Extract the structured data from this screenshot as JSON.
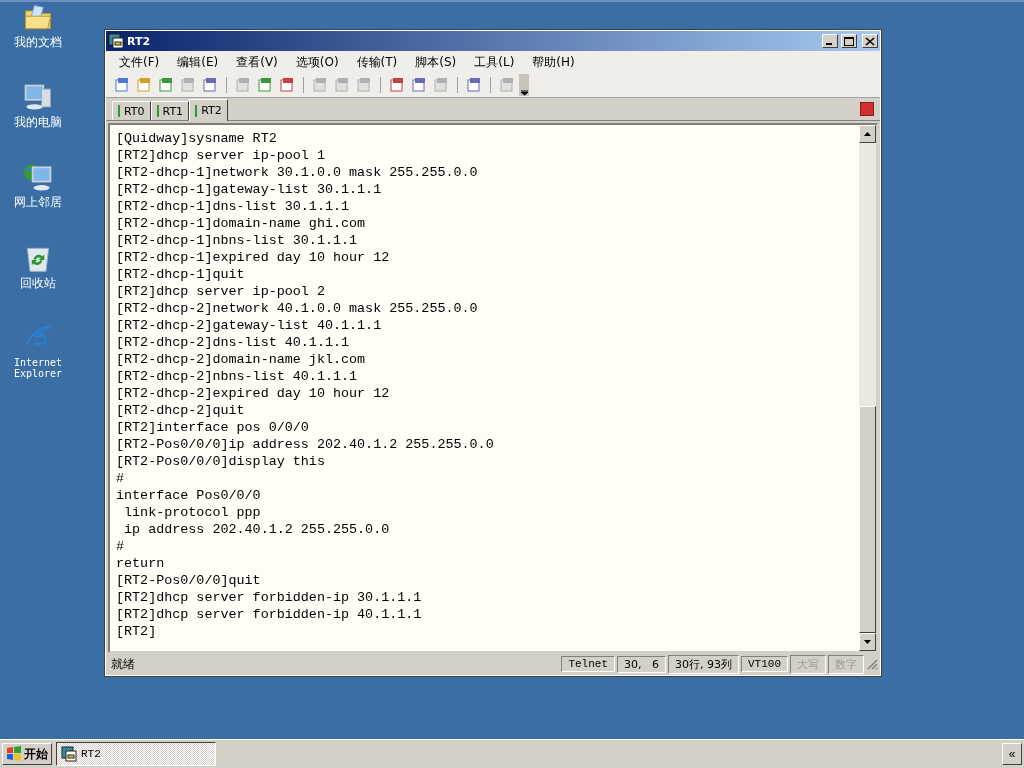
{
  "desktop_icons": [
    {
      "label": "我的文档",
      "kind": "folder"
    },
    {
      "label": "我的电脑",
      "kind": "computer"
    },
    {
      "label": "网上邻居",
      "kind": "network"
    },
    {
      "label": "回收站",
      "kind": "recycle"
    },
    {
      "label": "Internet Explorer",
      "kind": "browser"
    }
  ],
  "window": {
    "title": "RT2"
  },
  "menu": [
    "文件(F)",
    "编辑(E)",
    "查看(V)",
    "选项(O)",
    "传输(T)",
    "脚本(S)",
    "工具(L)",
    "帮助(H)"
  ],
  "toolbar_groups": [
    [
      {
        "disabled": false
      },
      {
        "disabled": false
      },
      {
        "disabled": false
      },
      {
        "disabled": true
      },
      {
        "disabled": false
      }
    ],
    [
      {
        "disabled": true
      },
      {
        "disabled": false
      },
      {
        "disabled": false
      }
    ],
    [
      {
        "disabled": true
      },
      {
        "disabled": true
      },
      {
        "disabled": true
      }
    ],
    [
      {
        "disabled": false
      },
      {
        "disabled": false
      },
      {
        "disabled": true
      }
    ],
    [
      {
        "disabled": false
      }
    ],
    [
      {
        "disabled": true
      }
    ]
  ],
  "tabs": [
    {
      "label": "RT0",
      "selected": false
    },
    {
      "label": "RT1",
      "selected": false
    },
    {
      "label": "RT2",
      "selected": true
    }
  ],
  "terminal_lines": [
    "[Quidway]sysname RT2",
    "[RT2]dhcp server ip-pool 1",
    "[RT2-dhcp-1]network 30.1.0.0 mask 255.255.0.0",
    "[RT2-dhcp-1]gateway-list 30.1.1.1",
    "[RT2-dhcp-1]dns-list 30.1.1.1",
    "[RT2-dhcp-1]domain-name ghi.com",
    "[RT2-dhcp-1]nbns-list 30.1.1.1",
    "[RT2-dhcp-1]expired day 10 hour 12",
    "[RT2-dhcp-1]quit",
    "[RT2]dhcp server ip-pool 2",
    "[RT2-dhcp-2]network 40.1.0.0 mask 255.255.0.0",
    "[RT2-dhcp-2]gateway-list 40.1.1.1",
    "[RT2-dhcp-2]dns-list 40.1.1.1",
    "[RT2-dhcp-2]domain-name jkl.com",
    "[RT2-dhcp-2]nbns-list 40.1.1.1",
    "[RT2-dhcp-2]expired day 10 hour 12",
    "[RT2-dhcp-2]quit",
    "[RT2]interface pos 0/0/0",
    "[RT2-Pos0/0/0]ip address 202.40.1.2 255.255.0.0",
    "[RT2-Pos0/0/0]display this",
    "#",
    "interface Pos0/0/0",
    " link-protocol ppp",
    " ip address 202.40.1.2 255.255.0.0",
    "#",
    "return",
    "[RT2-Pos0/0/0]quit",
    "[RT2]dhcp server forbidden-ip 30.1.1.1",
    "[RT2]dhcp server forbidden-ip 40.1.1.1",
    "[RT2]"
  ],
  "status_bar": {
    "message": "就绪",
    "panes": [
      {
        "text": "Telnet",
        "disabled": false
      },
      {
        "text": "30,   6",
        "disabled": false
      },
      {
        "text": "30行, 93列",
        "disabled": false
      },
      {
        "text": "VT100",
        "disabled": false
      },
      {
        "text": "大写",
        "disabled": true
      },
      {
        "text": "数字",
        "disabled": true
      }
    ]
  },
  "taskbar": {
    "start": "开始",
    "tasks": [
      {
        "label": "RT2",
        "selected": false
      }
    ],
    "tray_button": "«"
  }
}
